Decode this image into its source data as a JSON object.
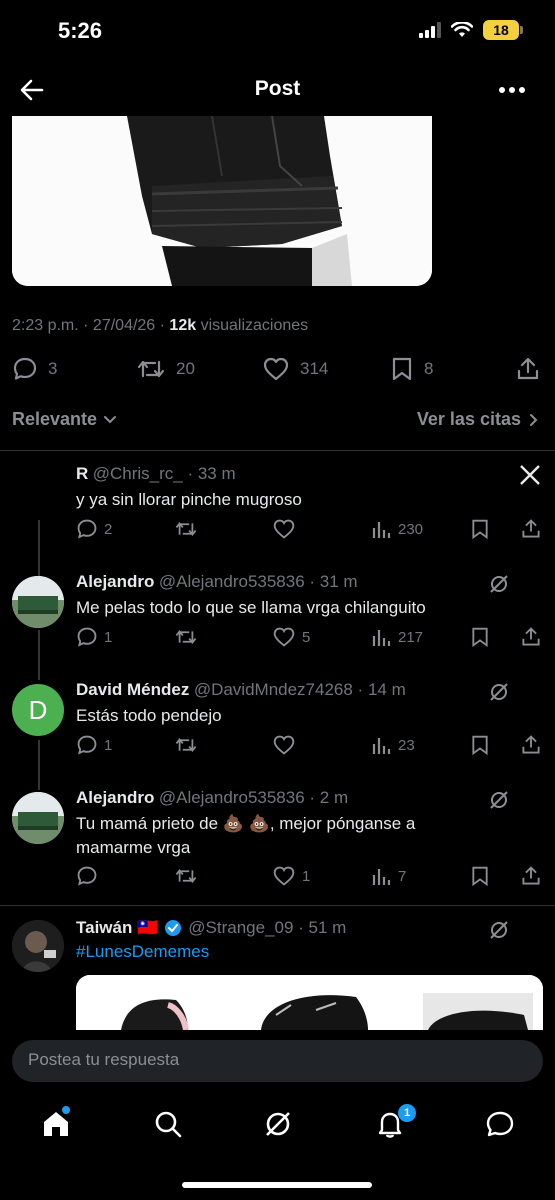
{
  "status": {
    "time": "5:26",
    "battery": "18"
  },
  "nav": {
    "title": "Post"
  },
  "post": {
    "time": "2:23 p.m. · 27/04/26 · ",
    "views_count": "12k",
    "views_label": " visualizaciones",
    "replies": "3",
    "reposts": "20",
    "likes": "314",
    "bookmarks": "8"
  },
  "sort": {
    "label": "Relevante",
    "quotes": "Ver las citas"
  },
  "replies": [
    {
      "name": "R",
      "handle": "@Chris_rc_ · 33 m",
      "text": "y ya sin llorar pinche mugroso",
      "replies": "2",
      "reposts": "",
      "likes": "",
      "views": "230"
    },
    {
      "name": "Alejandro",
      "handle": "@Alejandro535836 · 31 m",
      "text": "Me pelas todo lo que se llama vrga chilanguito",
      "replies": "1",
      "reposts": "",
      "likes": "5",
      "views": "217"
    },
    {
      "name": "David Méndez",
      "handle": "@DavidMndez74268 · 14 m",
      "avatar_letter": "D",
      "text": "Estás todo pendejo",
      "replies": "1",
      "reposts": "",
      "likes": "",
      "views": "23"
    },
    {
      "name": "Alejandro",
      "handle": "@Alejandro535836 · 2 m",
      "text_line1": "Tu mamá prieto de 💩 💩, mejor pónganse a",
      "text_line2": "mamarme vrga",
      "replies": "",
      "reposts": "",
      "likes": "1",
      "views": "7"
    },
    {
      "name": "Taiwán 🇹🇼",
      "handle": "@Strange_09 · 51 m",
      "text": "#LunesDememes"
    }
  ],
  "reply_box": {
    "placeholder": "Postea tu respuesta"
  },
  "tabbar": {
    "notifications_badge": "1"
  },
  "colors": {
    "accent": "#1d9bf0",
    "background": "#000000",
    "muted": "#71767b"
  }
}
